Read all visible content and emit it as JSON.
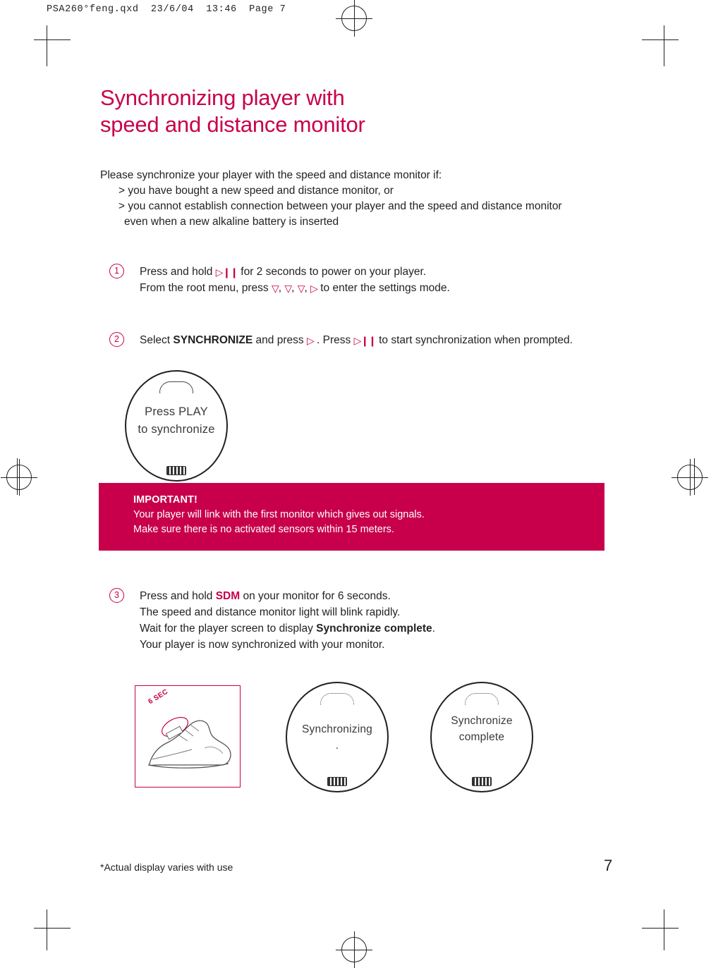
{
  "film_header": "PSA260°feng.qxd  23/6/04  13:46  Page 7",
  "title": {
    "line1": "Synchronizing player with",
    "line2": "speed and distance monitor",
    "color": "#c8004b"
  },
  "intro": {
    "lead": "Please synchronize your player with the speed and distance monitor if:",
    "bullet1": "> you have bought a new speed and distance monitor, or",
    "bullet2": "> you cannot establish connection between your player and the speed and distance monitor",
    "bullet2_cont": "even when a new alkaline battery is inserted"
  },
  "steps": [
    {
      "number": "1",
      "line1_a": "Press and hold",
      "line1_glyph": "▷❙❙",
      "line1_b": "for 2 seconds to power on your player.",
      "line2_a": "From the root menu,  press",
      "line2_glyphs": [
        "▽",
        "▽",
        "▽",
        "▷"
      ],
      "line2_b": "to enter the settings mode."
    },
    {
      "number": "2",
      "line1_a": "Select",
      "keyword": "SYNCHRONIZE",
      "line1_b": "and press",
      "glyph1": "▷",
      "line1_c": ".  Press",
      "glyph2": "▷❙❙",
      "line1_d": "to start synchronization when prompted."
    },
    {
      "number": "3",
      "line1_a": "Press and hold",
      "keyword": "SDM",
      "line1_b": "on your monitor for 6 seconds.",
      "line2": "The speed and distance monitor light will blink rapidly.",
      "line3_a": "Wait for the player screen to display",
      "line3_kw": "Synchronize complete",
      "line3_b": ".",
      "line4": "Your player is now synchronized with your monitor."
    }
  ],
  "watch_screens": [
    {
      "name": "press-play",
      "line1": "Press PLAY",
      "line2": "to synchronize"
    },
    {
      "name": "synchronizing",
      "line1": "Synchronizing",
      "line2": "."
    },
    {
      "name": "synchronize-complete",
      "line1": "Synchronize",
      "line2": "complete"
    }
  ],
  "important": {
    "heading": "IMPORTANT!",
    "line1": "Your player will link with the first monitor which gives out signals.",
    "line2": "Make sure there is no activated sensors within 15 meters.",
    "bg_color": "#c8004b"
  },
  "shoe_figure": {
    "label": "6 SEC"
  },
  "footer": {
    "footnote": "*Actual display varies with use",
    "page_number": "7"
  }
}
